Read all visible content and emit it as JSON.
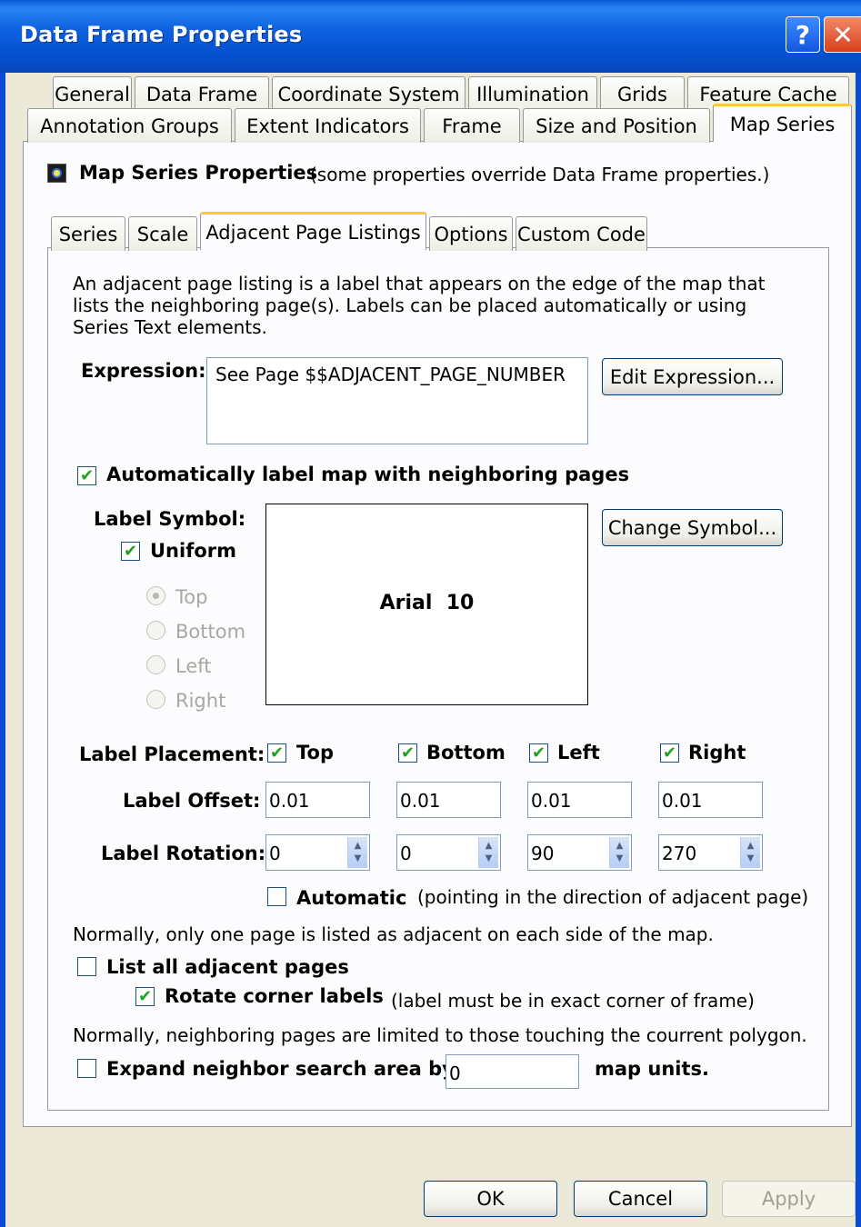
{
  "window": {
    "title": "Data Frame Properties",
    "help_label": "?",
    "close_label": "✕"
  },
  "top_tabs_row1": [
    "General",
    "Data Frame",
    "Coordinate System",
    "Illumination",
    "Grids",
    "Feature Cache"
  ],
  "top_tabs_row2": [
    "Annotation Groups",
    "Extent Indicators",
    "Frame",
    "Size and Position",
    "Map Series"
  ],
  "map_series": {
    "header_title": "Map Series Properties",
    "header_note": "(some properties override Data Frame properties.)"
  },
  "sub_tabs": [
    "Series",
    "Scale",
    "Adjacent Page Listings",
    "Options",
    "Custom Code"
  ],
  "adjacent": {
    "description": "An adjacent page listing is a label that appears on the edge of the map that lists the neighboring page(s). Labels can be placed automatically or using Series Text elements.",
    "expression_label": "Expression:",
    "expression_value": "See Page $$ADJACENT_PAGE_NUMBER",
    "edit_expression_button": "Edit Expression...",
    "auto_label_checkbox": "Automatically label map with neighboring pages",
    "auto_label_checked": true,
    "label_symbol_label": "Label Symbol:",
    "uniform_label": "Uniform",
    "uniform_checked": true,
    "radio_top": "Top",
    "radio_bottom": "Bottom",
    "radio_left": "Left",
    "radio_right": "Right",
    "symbol_preview": "Arial  10",
    "change_symbol_button": "Change Symbol...",
    "label_placement_label": "Label Placement:",
    "placement_top": "Top",
    "placement_bottom": "Bottom",
    "placement_left": "Left",
    "placement_right": "Right",
    "label_offset_label": "Label Offset:",
    "offset_top": "0.01",
    "offset_bottom": "0.01",
    "offset_left": "0.01",
    "offset_right": "0.01",
    "label_rotation_label": "Label Rotation:",
    "rotation_top": "0",
    "rotation_bottom": "0",
    "rotation_left": "90",
    "rotation_right": "270",
    "automatic_label": "Automatic",
    "automatic_note": "(pointing in the direction of adjacent page)",
    "note_one_page": "Normally, only one page is listed as adjacent on each side of the map.",
    "list_all_label": "List all adjacent pages",
    "rotate_corner_label": "Rotate corner labels",
    "rotate_corner_note": "(label must be in exact corner of frame)",
    "note_neighbors": "Normally, neighboring pages are limited to those touching the courrent polygon.",
    "expand_label": "Expand neighbor search area by",
    "expand_value": "0",
    "map_units_label": "map units."
  },
  "footer": {
    "ok": "OK",
    "cancel": "Cancel",
    "apply": "Apply"
  }
}
